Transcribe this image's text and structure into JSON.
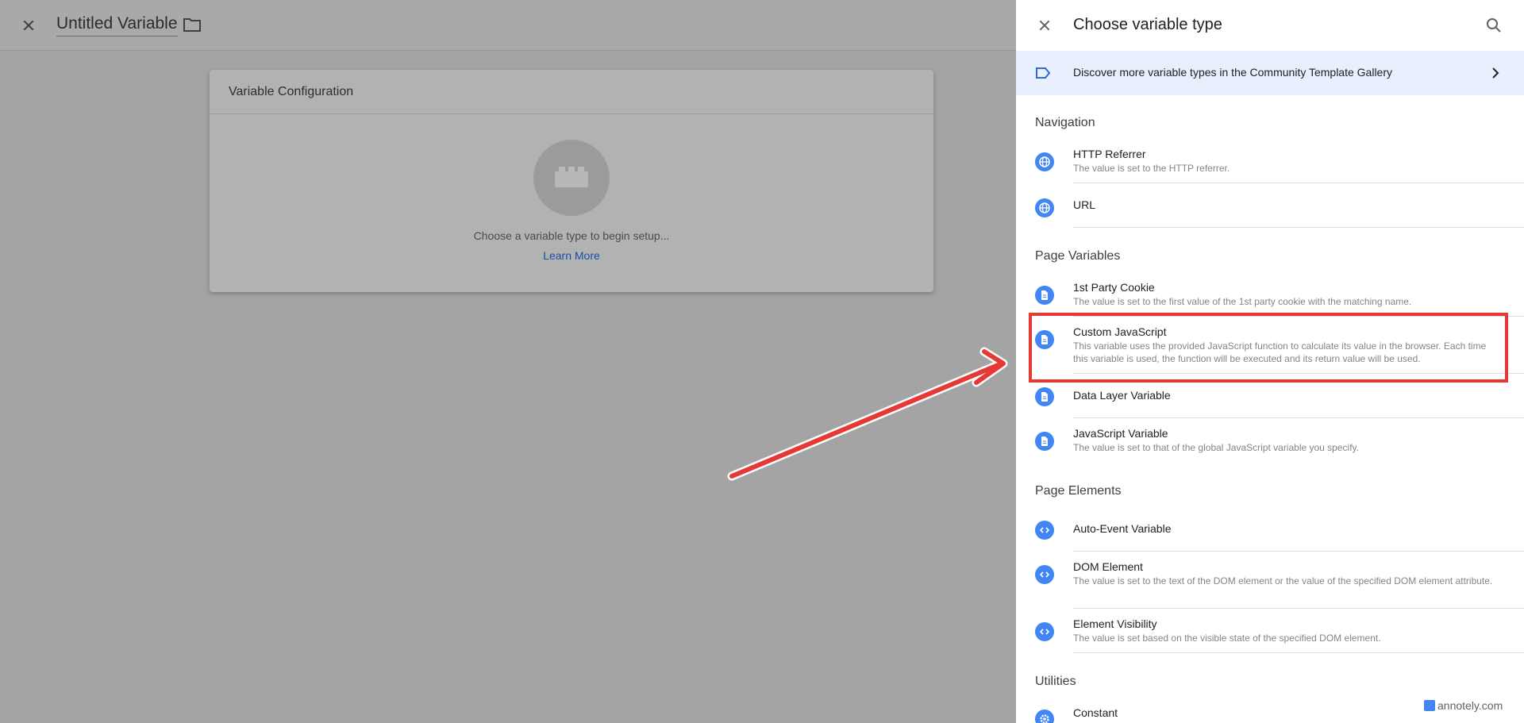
{
  "editor": {
    "title": "Untitled Variable",
    "card_title": "Variable Configuration",
    "hint": "Choose a variable type to begin setup...",
    "learn_more": "Learn More"
  },
  "panel": {
    "title": "Choose variable type",
    "discover": "Discover more variable types in the Community Template Gallery",
    "sections": {
      "navigation": "Navigation",
      "page_variables": "Page Variables",
      "page_elements": "Page Elements",
      "utilities": "Utilities"
    },
    "items": [
      {
        "name": "HTTP Referrer",
        "desc": "The value is set to the HTTP referrer.",
        "icon": "globe-icon"
      },
      {
        "name": "URL",
        "desc": "",
        "icon": "globe-icon"
      },
      {
        "name": "1st Party Cookie",
        "desc": "The value is set to the first value of the 1st party cookie with the matching name.",
        "icon": "document-icon"
      },
      {
        "name": "Custom JavaScript",
        "desc": "This variable uses the provided JavaScript function to calculate its value in the browser. Each time this variable is used, the function will be executed and its return value will be used.",
        "icon": "document-icon"
      },
      {
        "name": "Data Layer Variable",
        "desc": "",
        "icon": "document-icon"
      },
      {
        "name": "JavaScript Variable",
        "desc": "The value is set to that of the global JavaScript variable you specify.",
        "icon": "document-icon"
      },
      {
        "name": "Auto-Event Variable",
        "desc": "",
        "icon": "code-icon"
      },
      {
        "name": "DOM Element",
        "desc": "The value is set to the text of the DOM element or the value of the specified DOM element attribute.",
        "icon": "code-icon"
      },
      {
        "name": "Element Visibility",
        "desc": "The value is set based on the visible state of the specified DOM element.",
        "icon": "code-icon"
      },
      {
        "name": "Constant",
        "desc": "",
        "icon": "gear-icon"
      }
    ]
  },
  "watermark": "annotely.com",
  "colors": {
    "accent": "#4285f4",
    "highlight": "#e53935",
    "discover_bg": "#e8f0fe"
  }
}
